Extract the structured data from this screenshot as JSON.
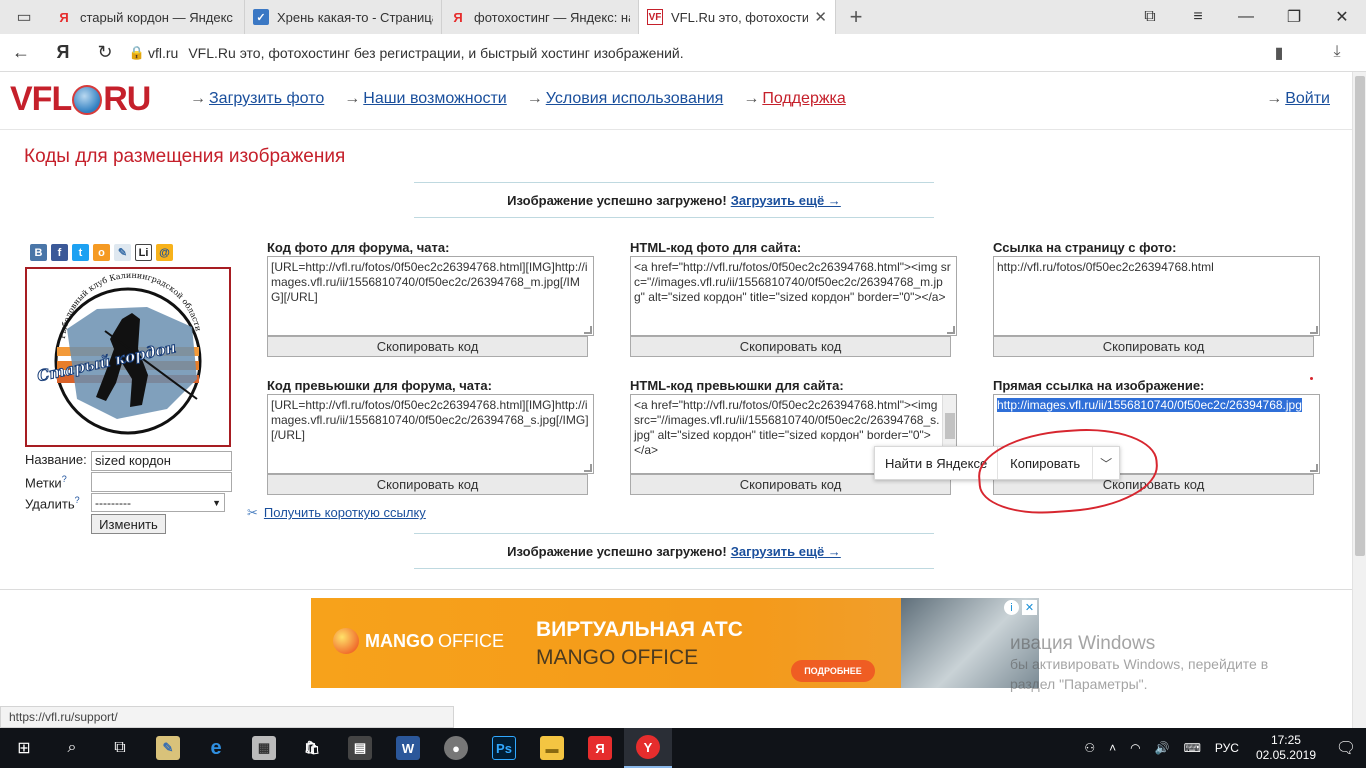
{
  "browser": {
    "tabs": [
      {
        "title": "старый кордон — Яндекс",
        "favicon": "Я",
        "active": false
      },
      {
        "title": "Хрень какая-то - Страница",
        "favicon": "✓",
        "active": false
      },
      {
        "title": "фотохостинг — Яндекс: на",
        "favicon": "Я",
        "active": false
      },
      {
        "title": "VFL.Ru это, фотохостинг",
        "favicon": "VF",
        "active": true
      }
    ],
    "url_domain": "vfl.ru",
    "url_title": "VFL.Ru это, фотохостинг без регистрации, и быстрый хостинг изображений."
  },
  "site": {
    "logo_left": "VFL",
    "logo_right": "RU",
    "nav": [
      {
        "label": "Загрузить фото"
      },
      {
        "label": "Наши возможности"
      },
      {
        "label": "Условия использования"
      },
      {
        "label": "Поддержка"
      }
    ],
    "login": "Войти"
  },
  "page": {
    "heading": "Коды для размещения изображения",
    "notice_text": "Изображение успешно загружено!",
    "notice_link": "Загрузить ещё →",
    "share_icons": [
      "В",
      "f",
      "t",
      "o",
      "✎",
      "Li",
      "@"
    ],
    "thumbnail": {
      "arc_text": "Рыболовный клуб Калининградской области",
      "title_text": "Старый кордон"
    },
    "meta": {
      "name_label": "Название:",
      "name_value": "sized кордон",
      "tags_label": "Метки",
      "tags_value": "",
      "delete_label": "Удалить",
      "delete_value": "---------",
      "question_mark": "?",
      "submit": "Изменить"
    },
    "short_link": "Получить короткую ссылку",
    "copy_button": "Скопировать код",
    "blocks": [
      {
        "title": "Код фото для форума, чата:",
        "code": "[URL=http://vfl.ru/fotos/0f50ec2c26394768.html][IMG]http://images.vfl.ru/ii/1556810740/0f50ec2c/26394768_m.jpg[/IMG][/URL]"
      },
      {
        "title": "HTML-код фото для сайта:",
        "code": "<a href=\"http://vfl.ru/fotos/0f50ec2c26394768.html\"><img src=\"//images.vfl.ru/ii/1556810740/0f50ec2c/26394768_m.jpg\" alt=\"sized кордон\" title=\"sized кордон\" border=\"0\"></a>"
      },
      {
        "title": "Ссылка на страницу с фото:",
        "code": "http://vfl.ru/fotos/0f50ec2c26394768.html"
      },
      {
        "title": "Код превьюшки для форума, чата:",
        "code": "[URL=http://vfl.ru/fotos/0f50ec2c26394768.html][IMG]http://images.vfl.ru/ii/1556810740/0f50ec2c/26394768_s.jpg[/IMG][/URL]"
      },
      {
        "title": "HTML-код превьюшки для сайта:",
        "code": "<a href=\"http://vfl.ru/fotos/0f50ec2c26394768.html\"><img src=\"//images.vfl.ru/ii/1556810740/0f50ec2c/26394768_s.jpg\" alt=\"sized кордон\" title=\"sized кордон\" border=\"0\"></a>"
      },
      {
        "title": "Прямая ссылка на изображение:",
        "code": "http://images.vfl.ru/ii/1556810740/0f50ec2c/26394768.jpg"
      }
    ]
  },
  "context_menu": {
    "find": "Найти в Яндексе",
    "copy": "Копировать"
  },
  "ad": {
    "logo": "MANGO",
    "logo_thin": "OFFICE",
    "headline": "ВИРТУАЛЬНАЯ АТС",
    "sub": "MANGO OFFICE",
    "cta": "ПОДРОБНЕЕ"
  },
  "watermark": {
    "line1": "ивация Windows",
    "line2": "бы активировать Windows, перейдите в",
    "line3": "раздел \"Параметры\"."
  },
  "status_bar_url": "https://vfl.ru/support/",
  "taskbar": {
    "language": "РУС",
    "time": "17:25",
    "date": "02.05.2019"
  },
  "colors": {
    "brand_red": "#c5202b",
    "link_blue": "#1a4f9c",
    "annotation_red": "#d7262f"
  }
}
